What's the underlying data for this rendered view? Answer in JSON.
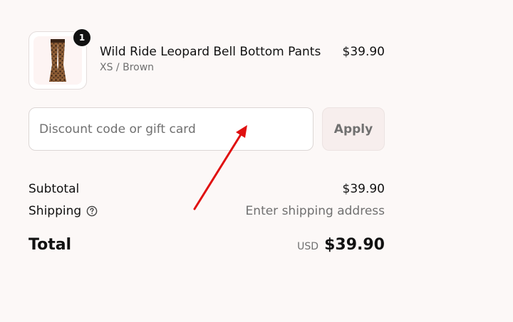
{
  "cart": {
    "items": [
      {
        "name": "Wild Ride Leopard Bell Bottom Pants",
        "variant": "XS / Brown",
        "price": "$39.90",
        "quantity": "1",
        "image_icon": "leopard-bell-bottom-pants-image"
      }
    ]
  },
  "discount": {
    "placeholder": "Discount code or gift card",
    "value": "",
    "apply_label": "Apply"
  },
  "summary": {
    "subtotal_label": "Subtotal",
    "subtotal_value": "$39.90",
    "shipping_label": "Shipping",
    "shipping_value": "Enter shipping address",
    "shipping_help_icon": "question-circle-icon",
    "total_label": "Total",
    "currency": "USD",
    "total_value": "$39.90"
  },
  "colors": {
    "background": "#fcf8f7",
    "text_primary": "#111111",
    "text_muted": "#707070",
    "annotation_arrow": "#e01010"
  }
}
